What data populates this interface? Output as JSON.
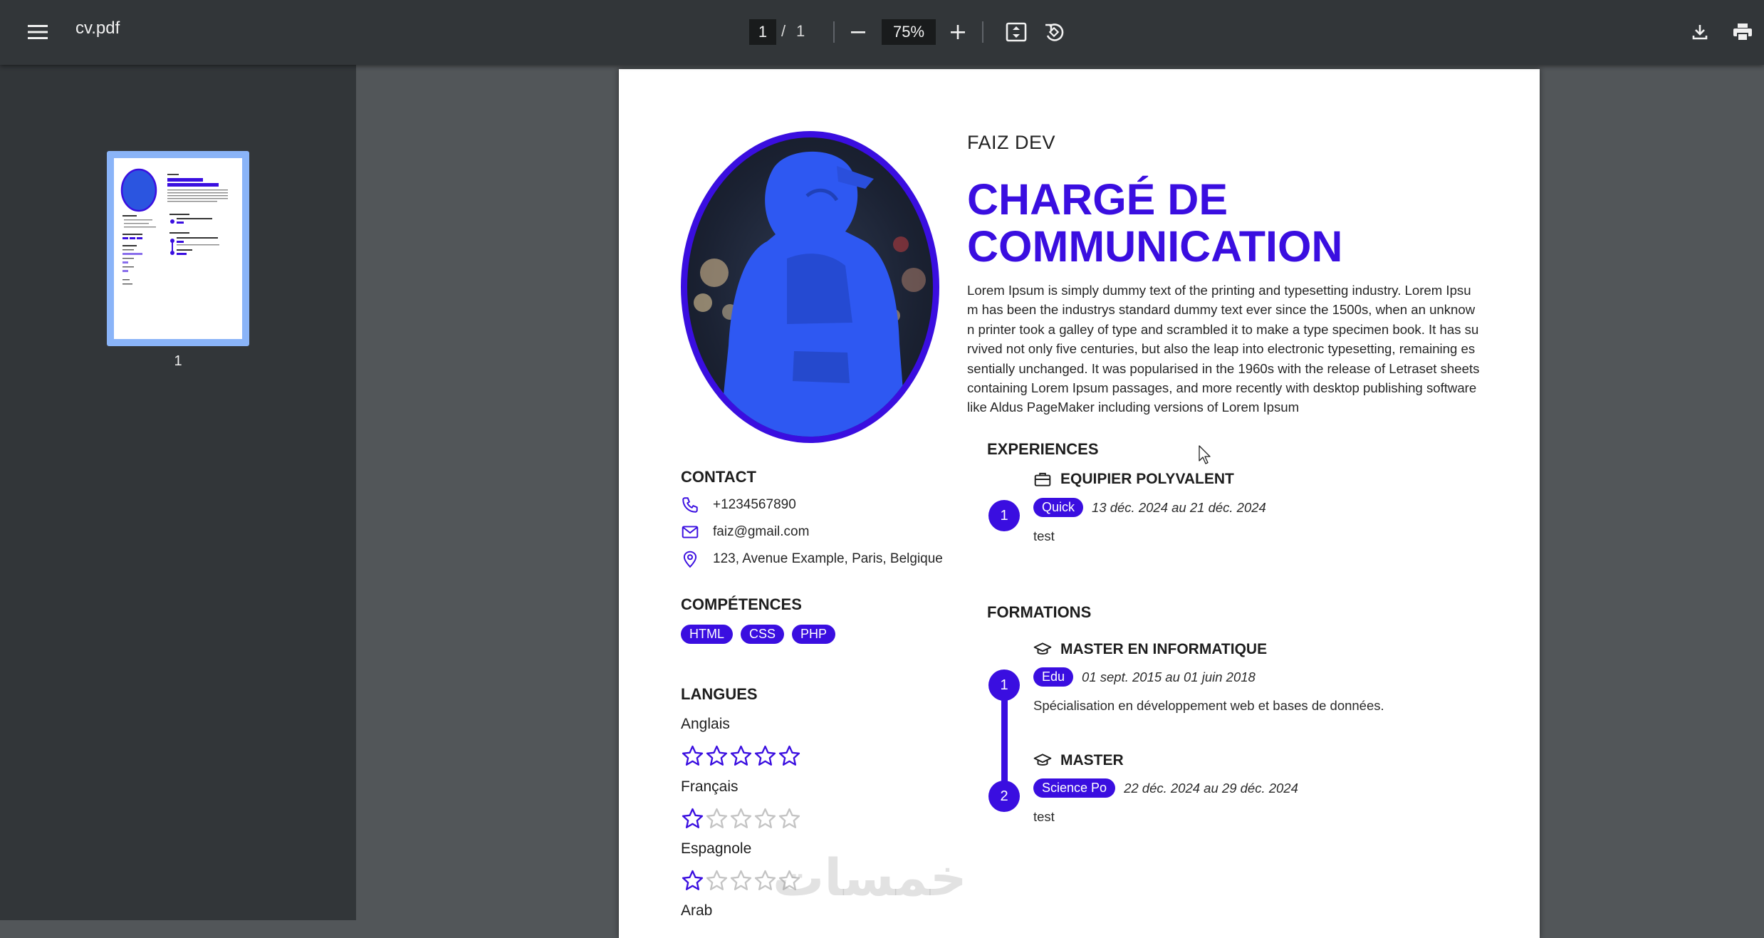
{
  "toolbar": {
    "filename": "cv.pdf",
    "current_page": "1",
    "page_separator": "/",
    "total_pages": "1",
    "zoom": "75%",
    "icons": [
      "menu-icon",
      "zoom-out-icon",
      "zoom-in-icon",
      "fit-page-icon",
      "rotate-icon",
      "download-icon",
      "print-icon"
    ]
  },
  "sidebar": {
    "thumbnail_label": "1"
  },
  "cv": {
    "name": "FAIZ DEV",
    "title": "CHARGÉ DE COMMUNICATION",
    "bio": "Lorem Ipsum is simply dummy text of the printing and typesetting industry. Lorem Ipsum has been the industrys standard dummy text ever since the 1500s, when an unknown printer took a galley of type and scrambled it to make a type specimen book. It has survived not only five centuries, but also the leap into electronic typesetting, remaining essentially unchanged. It was popularised in the 1960s with the release of Letraset sheets containing Lorem Ipsum passages, and more recently with desktop publishing software like Aldus PageMaker including versions of Lorem Ipsum",
    "contact": {
      "heading": "CONTACT",
      "phone": "+1234567890",
      "email": "faiz@gmail.com",
      "address": "123, Avenue Example, Paris, Belgique"
    },
    "skills": {
      "heading": "COMPÉTENCES",
      "items": [
        "HTML",
        "CSS",
        "PHP"
      ]
    },
    "languages": {
      "heading": "LANGUES",
      "items": [
        {
          "name": "Anglais",
          "rating": 5,
          "max": 5
        },
        {
          "name": "Français",
          "rating": 1,
          "max": 5
        },
        {
          "name": "Espagnole",
          "rating": 1,
          "max": 5
        },
        {
          "name": "Arab",
          "rating": 0,
          "max": 5
        }
      ]
    },
    "experiences": {
      "heading": "EXPERIENCES",
      "items": [
        {
          "num": "1",
          "title": "EQUIPIER POLYVALENT",
          "org": "Quick",
          "dates": "13 déc. 2024 au 21 déc. 2024",
          "desc": "test"
        }
      ]
    },
    "formations": {
      "heading": "FORMATIONS",
      "items": [
        {
          "num": "1",
          "title": "MASTER EN INFORMATIQUE",
          "org": "Edu",
          "dates": "01 sept. 2015 au 01 juin 2018",
          "desc": "Spécialisation en développement web et bases de données."
        },
        {
          "num": "2",
          "title": "MASTER",
          "org": "Science Po",
          "dates": "22 déc. 2024 au 29 déc. 2024",
          "desc": "test"
        }
      ]
    }
  },
  "colors": {
    "accent": "#3a0ee0",
    "toolbar": "#323639",
    "viewer_bg": "#525659"
  },
  "watermark_text": "خمسات"
}
